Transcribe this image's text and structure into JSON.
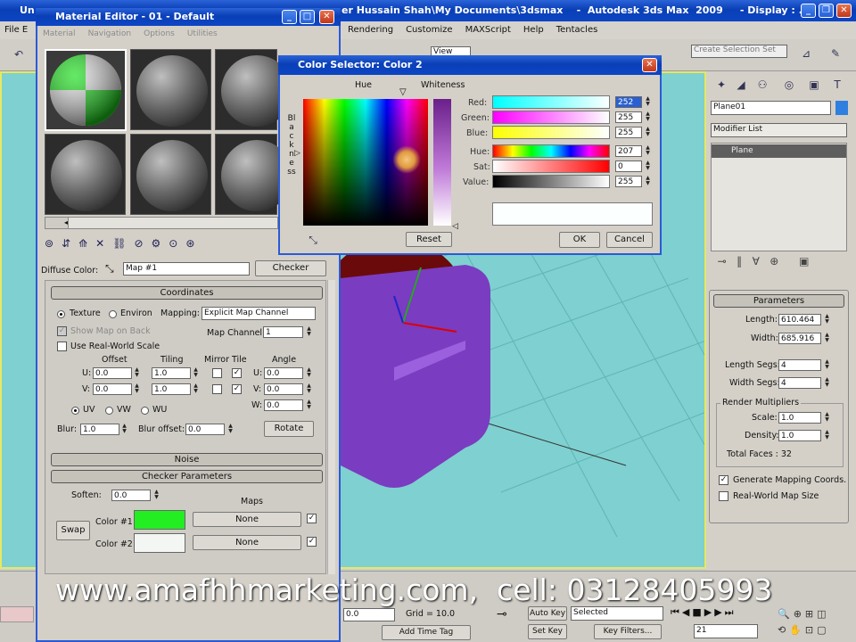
{
  "max_title": {
    "left": "Un",
    "right": "er Hussain Shah\\My Documents\\3dsmax    -  Autodesk 3ds Max  2009     - Display : ..."
  },
  "max_menu": {
    "left": "File  E",
    "items": [
      "Rendering",
      "Customize",
      "MAXScript",
      "Help",
      "Tentacles"
    ]
  },
  "toolbar": {
    "view_dropdown": "View",
    "selection_set": "Create Selection Set"
  },
  "cmd": {
    "object_name": "Plane01",
    "modifier_list": "Modifier List",
    "stack_item": "Plane"
  },
  "parameters": {
    "title": "Parameters",
    "length_label": "Length:",
    "length": "610.464",
    "width_label": "Width:",
    "width": "685.916",
    "length_segs_label": "Length Segs:",
    "length_segs": "4",
    "width_segs_label": "Width Segs:",
    "width_segs": "4",
    "render_mult_label": "Render Multipliers",
    "scale_label": "Scale:",
    "scale": "1.0",
    "density_label": "Density:",
    "density": "1.0",
    "total_faces": "Total Faces : 32",
    "gen_mapping": "Generate Mapping Coords.",
    "real_world": "Real-World Map Size"
  },
  "material_editor": {
    "title": "Material Editor - 01 - Default",
    "menu": [
      "Material",
      "Navigation",
      "Options",
      "Utilities"
    ],
    "diffuse_label": "Diffuse Color:",
    "map_name": "Map #1",
    "map_type": "Checker"
  },
  "coordinates": {
    "title": "Coordinates",
    "texture": "Texture",
    "environ": "Environ",
    "mapping_label": "Mapping:",
    "mapping": "Explicit Map Channel",
    "show_map": "Show Map on Back",
    "map_channel_label": "Map Channel:",
    "map_channel": "1",
    "use_real_world": "Use Real-World Scale",
    "offset": "Offset",
    "tiling": "Tiling",
    "mirror_tile": "Mirror Tile",
    "angle": "Angle",
    "u": "U:",
    "v": "V:",
    "w": "W:",
    "u_offset": "0.0",
    "v_offset": "0.0",
    "u_tiling": "1.0",
    "v_tiling": "1.0",
    "u_angle": "0.0",
    "v_angle": "0.0",
    "w_angle": "0.0",
    "uv": "UV",
    "vw": "VW",
    "wu": "WU",
    "blur_label": "Blur:",
    "blur": "1.0",
    "blur_offset_label": "Blur offset:",
    "blur_offset": "0.0",
    "rotate": "Rotate"
  },
  "noise": {
    "title": "Noise"
  },
  "checker": {
    "title": "Checker Parameters",
    "soften_label": "Soften:",
    "soften": "0.0",
    "maps": "Maps",
    "swap": "Swap",
    "color1_label": "Color #1:",
    "color2_label": "Color #2:",
    "none": "None",
    "color1": "#22ee22",
    "color2": "#f4f6f4"
  },
  "color_selector": {
    "title": "Color Selector: Color 2",
    "hue_label": "Hue",
    "whiteness_label": "Whiteness",
    "blackness_label": "Blackness",
    "red_label": "Red:",
    "green_label": "Green:",
    "blue_label": "Blue:",
    "hue_ch_label": "Hue:",
    "sat_label": "Sat:",
    "value_label": "Value:",
    "red": "252",
    "green": "255",
    "blue": "255",
    "hue": "207",
    "sat": "0",
    "value": "255",
    "reset": "Reset",
    "ok": "OK",
    "cancel": "Cancel",
    "preview": "#fcffff"
  },
  "status": {
    "coord": "0.0",
    "grid": "Grid = 10.0",
    "auto_key": "Auto Key",
    "selected": "Selected",
    "set_key": "Set Key",
    "key_filters": "Key Filters...",
    "frame": "21",
    "add_time_tag": "Add Time Tag"
  },
  "watermark": "www.amafhhmarketing.com,  cell: 03128405993"
}
